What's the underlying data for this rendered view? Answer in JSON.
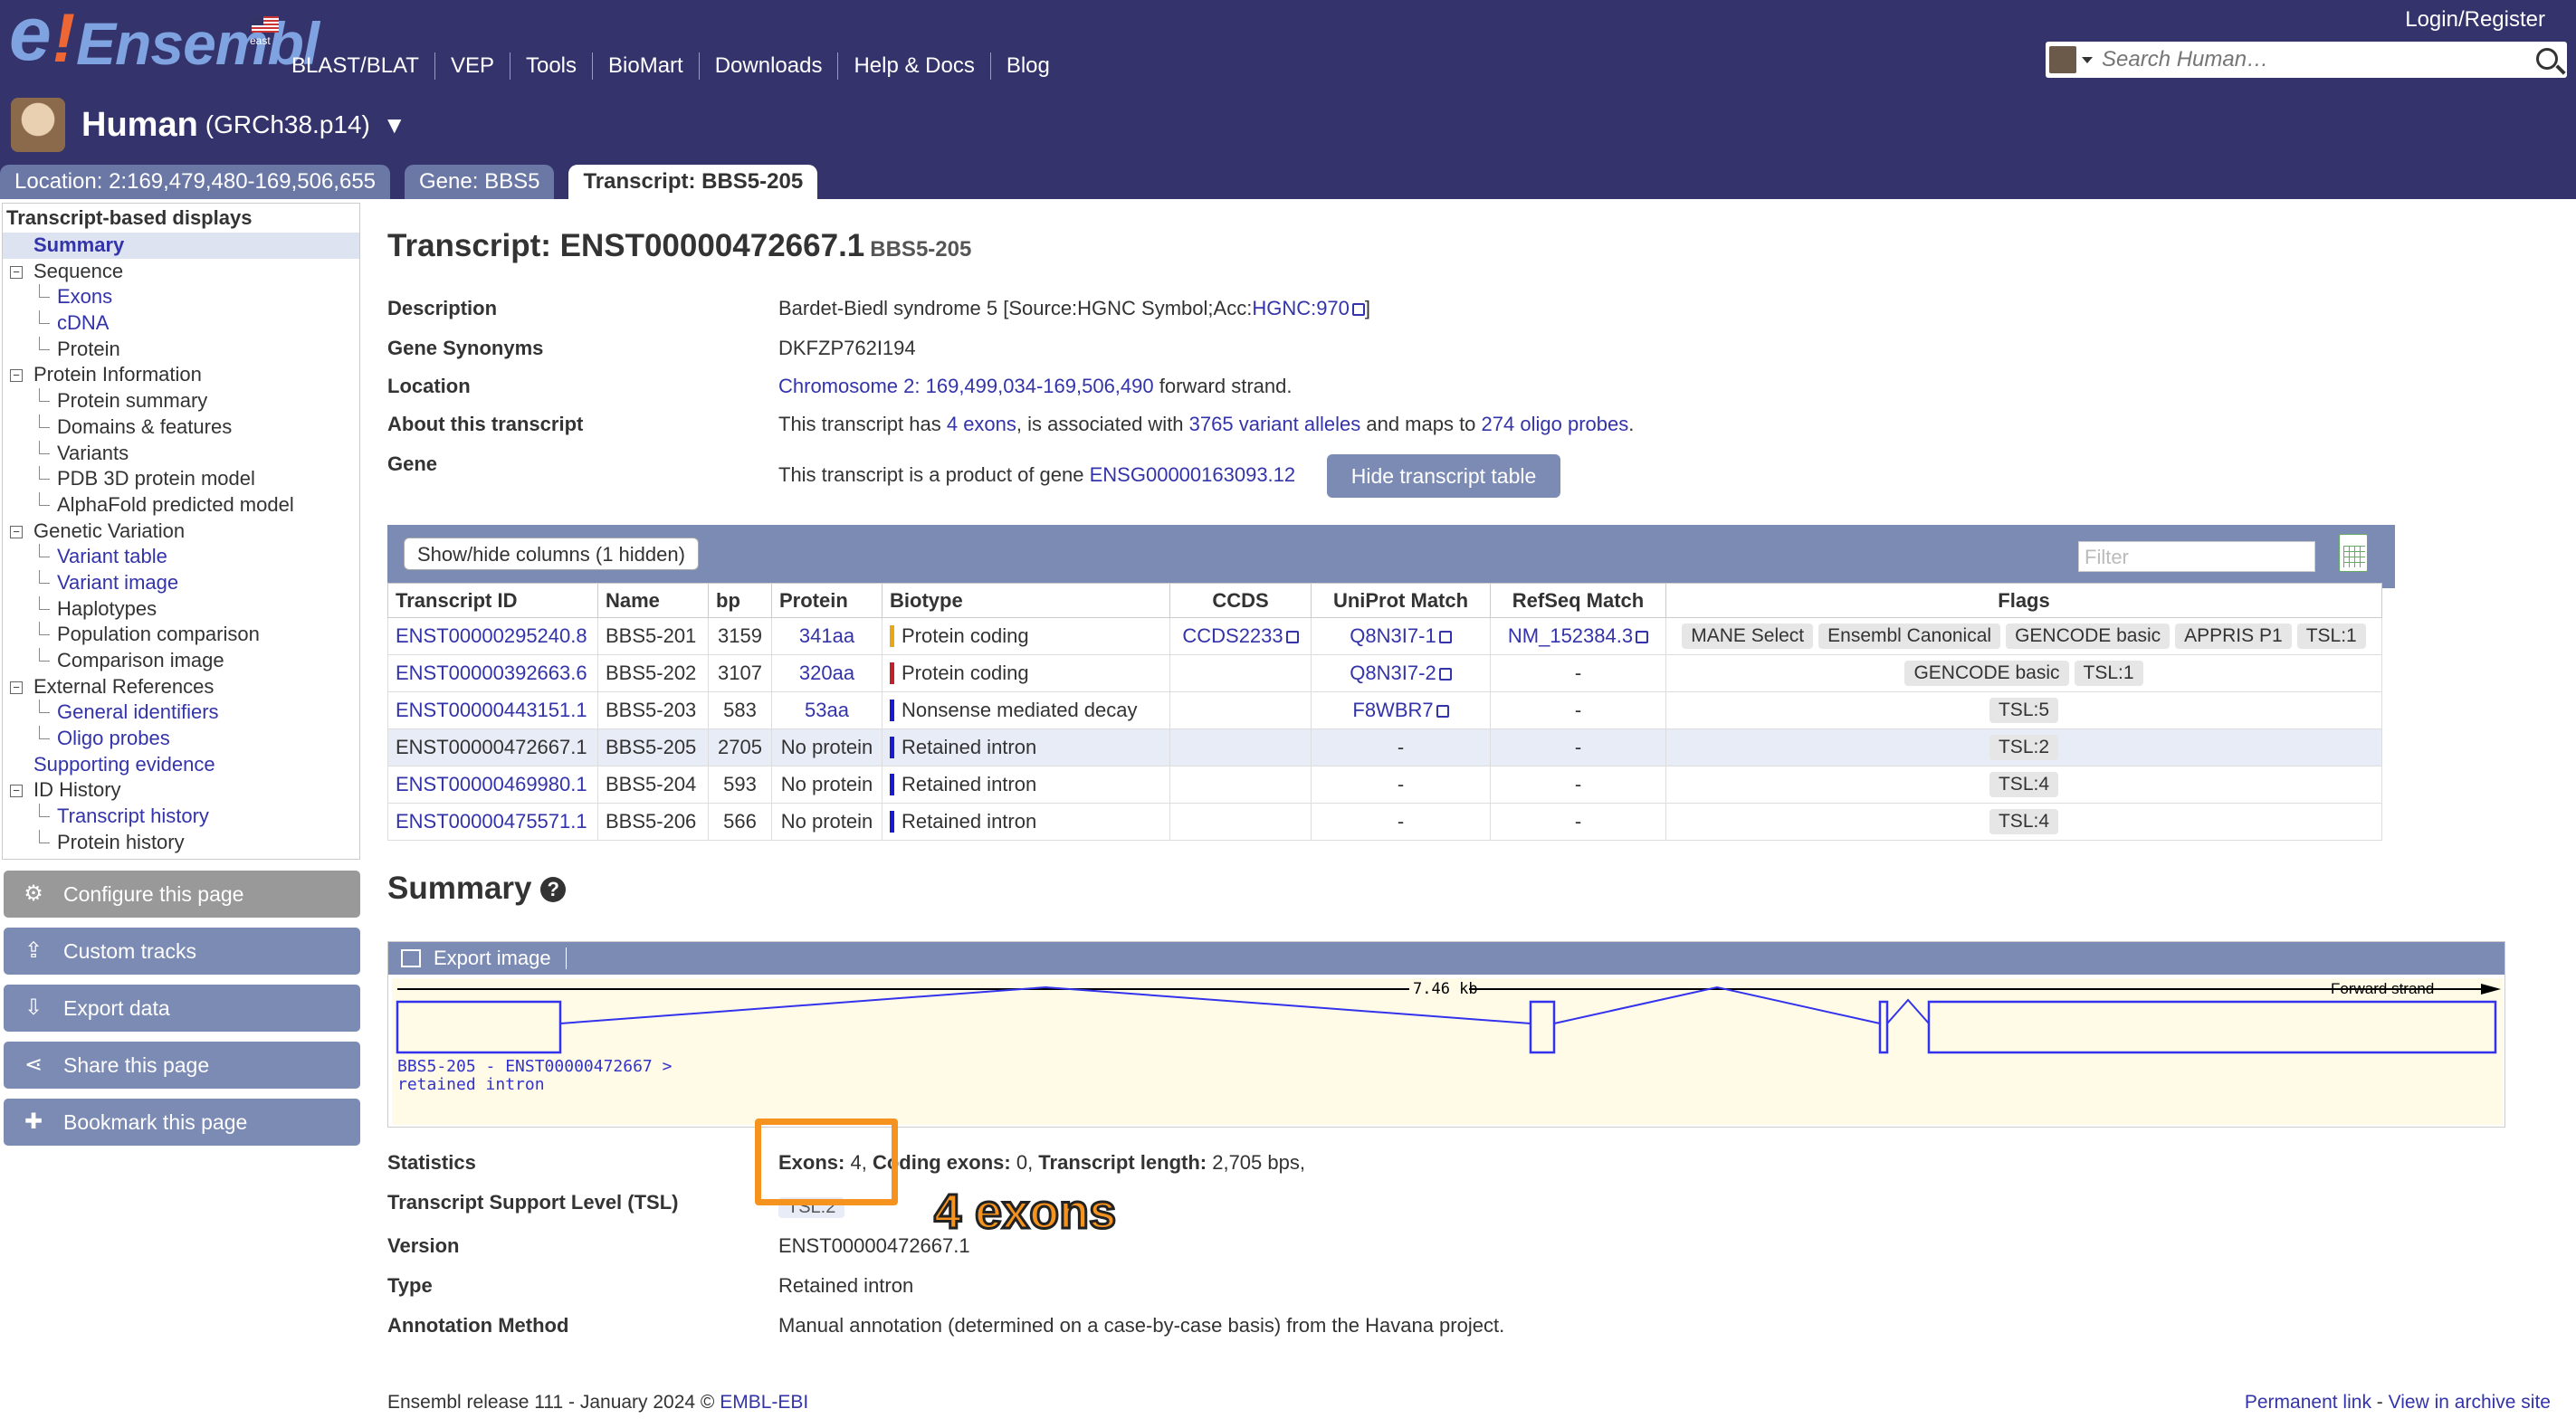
{
  "masthead": {
    "logo": {
      "e": "e",
      "bang": "!",
      "name": "Ensembl",
      "site": "east"
    },
    "nav": [
      "BLAST/BLAT",
      "VEP",
      "Tools",
      "BioMart",
      "Downloads",
      "Help & Docs",
      "Blog"
    ],
    "login": "Login/Register",
    "search_placeholder": "Search Human…",
    "species": {
      "name": "Human",
      "assembly": "(GRCh38.p14)",
      "arrow": "▼"
    },
    "tabs": [
      "Location: 2:169,479,480-169,506,655",
      "Gene: BBS5",
      "Transcript: BBS5-205"
    ]
  },
  "sidebar": {
    "heading": "Transcript-based displays",
    "items": [
      {
        "label": "Summary",
        "level": 0,
        "selected": true
      },
      {
        "label": "Sequence",
        "level": 0,
        "tree": "⊟"
      },
      {
        "label": "Exons",
        "level": 1,
        "link": true
      },
      {
        "label": "cDNA",
        "level": 1,
        "link": true
      },
      {
        "label": "Protein",
        "level": 1
      },
      {
        "label": "Protein Information",
        "level": 0,
        "tree": "⊟"
      },
      {
        "label": "Protein summary",
        "level": 1
      },
      {
        "label": "Domains & features",
        "level": 1
      },
      {
        "label": "Variants",
        "level": 1
      },
      {
        "label": "PDB 3D protein model",
        "level": 1
      },
      {
        "label": "AlphaFold predicted model",
        "level": 1
      },
      {
        "label": "Genetic Variation",
        "level": 0,
        "tree": "⊟"
      },
      {
        "label": "Variant table",
        "level": 1,
        "link": true
      },
      {
        "label": "Variant image",
        "level": 1,
        "link": true
      },
      {
        "label": "Haplotypes",
        "level": 1
      },
      {
        "label": "Population comparison",
        "level": 1
      },
      {
        "label": "Comparison image",
        "level": 1
      },
      {
        "label": "External References",
        "level": 0,
        "tree": "⊟"
      },
      {
        "label": "General identifiers",
        "level": 1,
        "link": true
      },
      {
        "label": "Oligo probes",
        "level": 1,
        "link": true
      },
      {
        "label": "Supporting evidence",
        "level": 0,
        "link": true
      },
      {
        "label": "ID History",
        "level": 0,
        "tree": "⊟"
      },
      {
        "label": "Transcript history",
        "level": 1,
        "link": true
      },
      {
        "label": "Protein history",
        "level": 1
      }
    ],
    "buttons": [
      {
        "label": "Configure this page",
        "icon": "⚙"
      },
      {
        "label": "Custom tracks",
        "icon": "⇪"
      },
      {
        "label": "Export data",
        "icon": "⇩"
      },
      {
        "label": "Share this page",
        "icon": "⋖"
      },
      {
        "label": "Bookmark this page",
        "icon": "✚"
      }
    ]
  },
  "main": {
    "title": "Transcript: ENST00000472667.1",
    "title_sub": "BBS5-205",
    "info": {
      "description_label": "Description",
      "description_text": "Bardet-Biedl syndrome 5 [Source:HGNC Symbol;Acc:",
      "description_link": "HGNC:970",
      "description_end": "]",
      "synonyms_label": "Gene Synonyms",
      "synonyms": "DKFZP762I194",
      "location_label": "Location",
      "location_link": "Chromosome 2: 169,499,034-169,506,490",
      "location_end": " forward strand.",
      "about_label": "About this transcript",
      "about_1": "This transcript has ",
      "about_exons": "4 exons",
      "about_2": ", is associated with ",
      "about_variants": "3765 variant alleles",
      "about_3": " and maps to ",
      "about_probes": "274 oligo probes",
      "about_4": ".",
      "gene_label": "Gene",
      "gene_text": "This transcript is a product of gene ",
      "gene_link": "ENSG00000163093.12",
      "hide_button": "Hide transcript table"
    },
    "table": {
      "showhide": "Show/hide columns (1 hidden)",
      "filter_placeholder": "Filter",
      "headers": [
        "Transcript ID",
        "Name",
        "bp",
        "Protein",
        "Biotype",
        "CCDS",
        "UniProt Match",
        "RefSeq Match",
        "Flags"
      ],
      "rows": [
        {
          "id": "ENST00000295240.8",
          "name": "BBS5-201",
          "bp": "3159",
          "protein": "341aa",
          "protein_link": true,
          "biotype": "Protein coding",
          "bcolor": "#e6a817",
          "ccds": "CCDS2233",
          "uniprot": "Q8N3I7-1",
          "refseq": "NM_152384.3",
          "flags": [
            "MANE Select",
            "Ensembl Canonical",
            "GENCODE basic",
            "APPRIS P1",
            "TSL:1"
          ]
        },
        {
          "id": "ENST00000392663.6",
          "name": "BBS5-202",
          "bp": "3107",
          "protein": "320aa",
          "protein_link": true,
          "biotype": "Protein coding",
          "bcolor": "#c0222a",
          "ccds": "",
          "uniprot": "Q8N3I7-2",
          "refseq": "-",
          "flags": [
            "GENCODE basic",
            "TSL:1"
          ]
        },
        {
          "id": "ENST00000443151.1",
          "name": "BBS5-203",
          "bp": "583",
          "protein": "53aa",
          "protein_link": true,
          "biotype": "Nonsense mediated decay",
          "bcolor": "#1a1acf",
          "ccds": "",
          "uniprot": "F8WBR7",
          "refseq": "-",
          "flags": [
            "TSL:5"
          ]
        },
        {
          "id": "ENST00000472667.1",
          "name": "BBS5-205",
          "bp": "2705",
          "protein": "No protein",
          "protein_link": false,
          "biotype": "Retained intron",
          "bcolor": "#1a1acf",
          "ccds": "",
          "uniprot": "-",
          "refseq": "-",
          "flags": [
            "TSL:2"
          ],
          "current": true
        },
        {
          "id": "ENST00000469980.1",
          "name": "BBS5-204",
          "bp": "593",
          "protein": "No protein",
          "protein_link": false,
          "biotype": "Retained intron",
          "bcolor": "#1a1acf",
          "ccds": "",
          "uniprot": "-",
          "refseq": "-",
          "flags": [
            "TSL:4"
          ]
        },
        {
          "id": "ENST00000475571.1",
          "name": "BBS5-206",
          "bp": "566",
          "protein": "No protein",
          "protein_link": false,
          "biotype": "Retained intron",
          "bcolor": "#1a1acf",
          "ccds": "",
          "uniprot": "-",
          "refseq": "-",
          "flags": [
            "TSL:4"
          ]
        }
      ]
    },
    "summary": {
      "heading": "Summary",
      "help": "?",
      "export_image": "Export image",
      "scale_label": "7.46 kb",
      "strand_label": "Forward strand",
      "track_label_1": "BBS5-205 - ENST00000472667 >",
      "track_label_2": "retained intron",
      "statistics_label": "Statistics",
      "stats_exons_label": "Exons:",
      "stats_exons": " 4,",
      "stats_coding_label": " Coding exons:",
      "stats_coding": " 0,",
      "stats_length_label": " Transcript length:",
      "stats_length": " 2,705 bps,",
      "tsl_label": "Transcript Support Level (TSL)",
      "tsl": "TSL:2",
      "version_label": "Version",
      "version": "ENST00000472667.1",
      "type_label": "Type",
      "type": "Retained intron",
      "annotation_label": "Annotation Method",
      "annotation": "Manual annotation (determined on a case-by-case basis) from the Havana project."
    },
    "callout": "4 exons"
  },
  "footer": {
    "release": "Ensembl release 111 - January 2024 © ",
    "embl": "EMBL-EBI",
    "permanent": "Permanent link",
    "sep": " - ",
    "archive": "View in archive site"
  }
}
